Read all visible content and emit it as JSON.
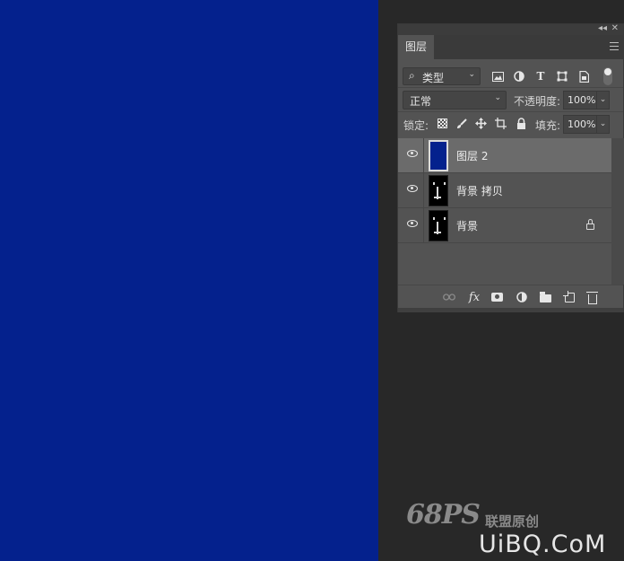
{
  "colors": {
    "canvas_fill": "#04218d",
    "workspace_bg": "#282828",
    "panel_bg": "#535353",
    "selected_row": "#6b6b6b"
  },
  "panel": {
    "tab_label": "图层",
    "collapse_glyph": "◂◂",
    "close_glyph": "✕",
    "menu_icon": "hamburger-icon"
  },
  "filter": {
    "kind_label": "类型",
    "kind_icon": "search-icon",
    "type_glyph": "T"
  },
  "blend": {
    "mode": "正常",
    "opacity_label": "不透明度:",
    "opacity_value": "100%"
  },
  "lock": {
    "label": "锁定:",
    "fill_label": "填充:",
    "fill_value": "100%"
  },
  "layers": [
    {
      "name": "图层 2",
      "selected": true,
      "visible": true,
      "locked": false,
      "thumbnail": "solid-blue"
    },
    {
      "name": "背景 拷贝",
      "selected": false,
      "visible": true,
      "locked": false,
      "thumbnail": "figure-on-black"
    },
    {
      "name": "背景",
      "selected": false,
      "visible": true,
      "locked": true,
      "thumbnail": "figure-on-black"
    }
  ],
  "footer": {
    "fx_label": "fx"
  },
  "watermark": {
    "logo": "68PS",
    "brand": "联盟原创",
    "url": "UiBQ.CoM"
  }
}
